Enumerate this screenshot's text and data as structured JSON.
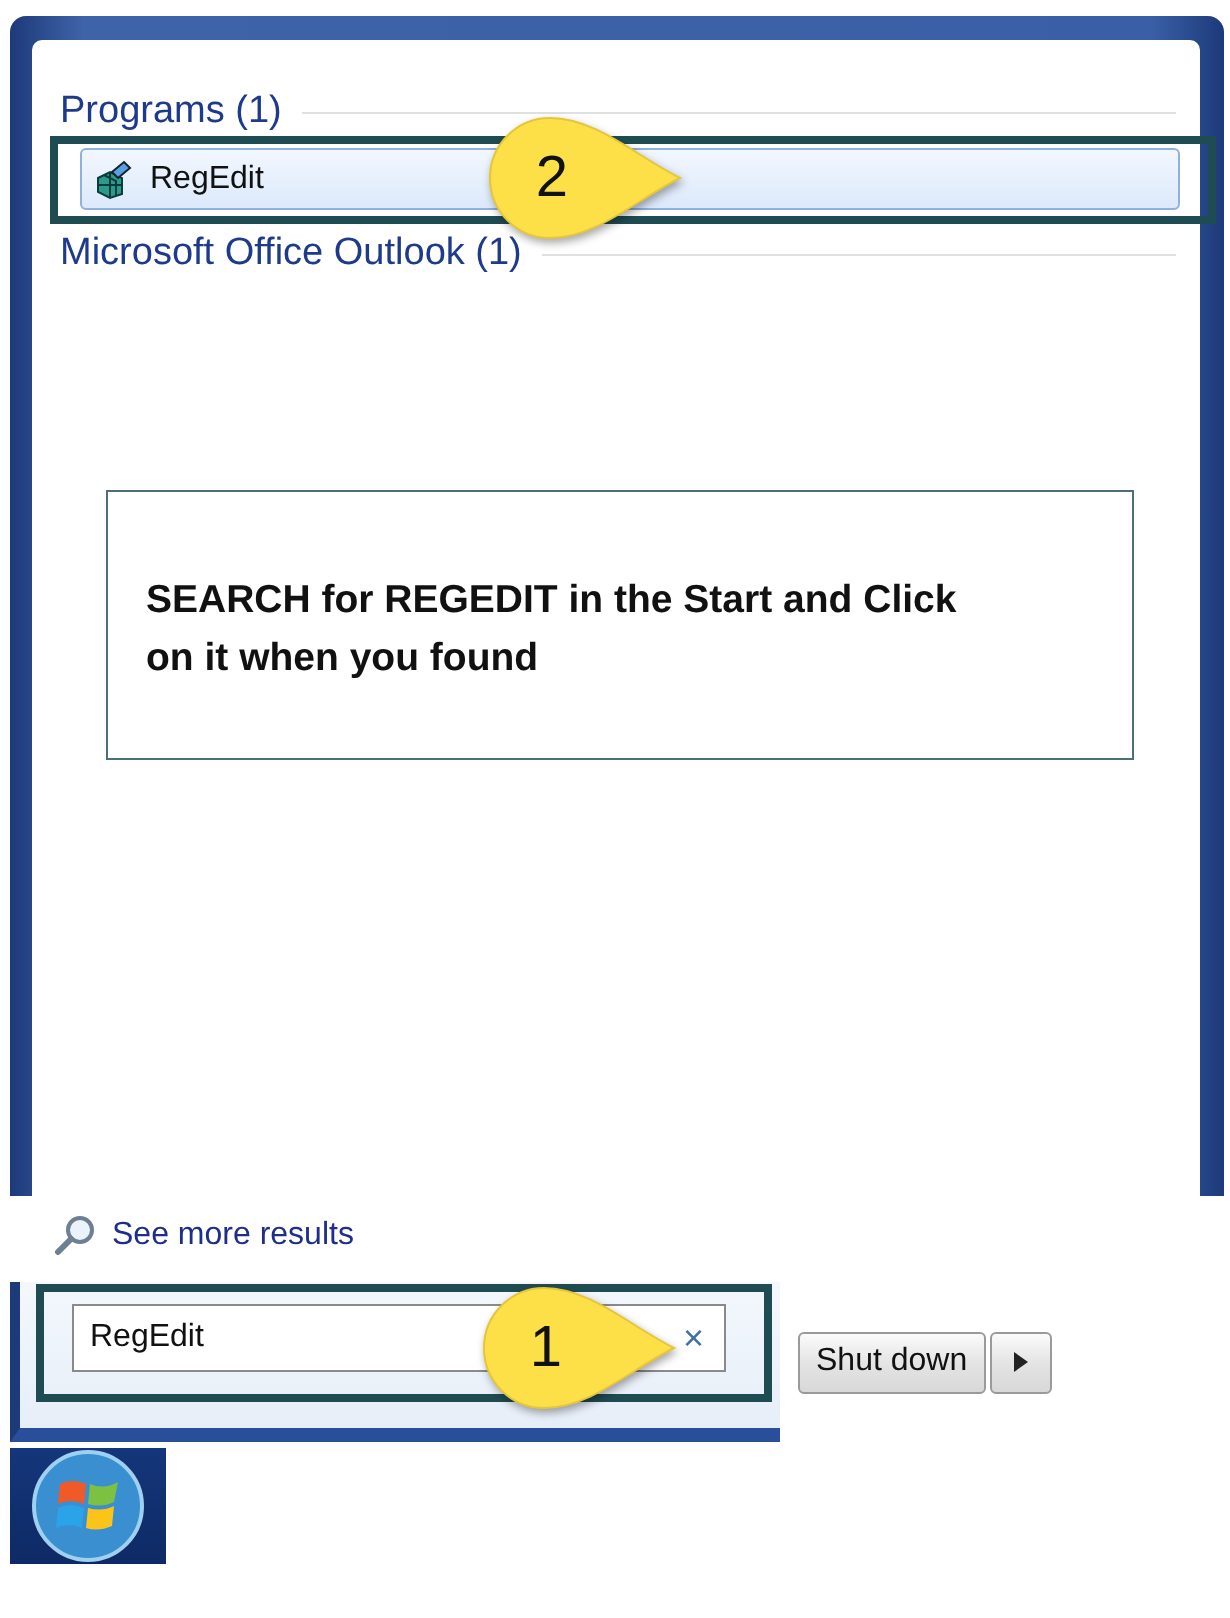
{
  "results": {
    "groups": [
      {
        "heading": "Programs (1)",
        "items": [
          {
            "label": "RegEdit",
            "selected": true,
            "callout": "2"
          }
        ]
      },
      {
        "heading": "Microsoft Office Outlook (1)"
      }
    ]
  },
  "note": "SEARCH for REGEDIT in the Start and Click on it when you found",
  "see_more": "See more results",
  "search": {
    "value": "RegEdit",
    "clear": "×",
    "callout": "1"
  },
  "shutdown": {
    "label": "Shut down"
  }
}
